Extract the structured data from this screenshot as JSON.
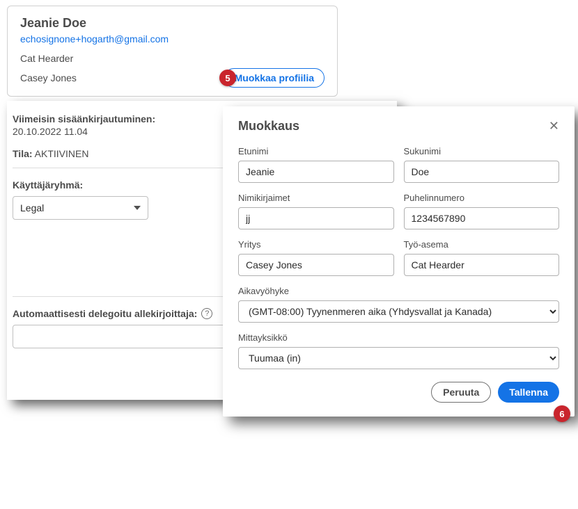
{
  "profile": {
    "name": "Jeanie Doe",
    "email": "echosignone+hogarth@gmail.com",
    "role": "Cat Hearder",
    "company": "Casey Jones",
    "edit_button": "Muokkaa profiilia"
  },
  "steps": {
    "five": "5",
    "six": "6"
  },
  "panel": {
    "last_login_label": "Viimeisin sisäänkirjautuminen:",
    "last_login_value": "20.10.2022 11.04",
    "status_label": "Tila:",
    "status_value": "AKTIIVINEN",
    "group_label": "Käyttäjäryhmä:",
    "group_value": "Legal",
    "delegate_label": "Automaattisesti delegoitu allekirjoittaja:"
  },
  "modal": {
    "title": "Muokkaus",
    "fields": {
      "firstname_label": "Etunimi",
      "firstname_value": "Jeanie",
      "lastname_label": "Sukunimi",
      "lastname_value": "Doe",
      "initials_label": "Nimikirjaimet",
      "initials_value": "jj",
      "phone_label": "Puhelinnumero",
      "phone_value": "1234567890",
      "company_label": "Yritys",
      "company_value": "Casey Jones",
      "jobtitle_label": "Työ-asema",
      "jobtitle_value": "Cat Hearder",
      "timezone_label": "Aikavyöhyke",
      "timezone_value": "(GMT-08:00) Tyynenmeren aika (Yhdysvallat ja Kanada)",
      "unit_label": "Mittayksikkö",
      "unit_value": "Tuumaa (in)"
    },
    "cancel": "Peruuta",
    "save": "Tallenna"
  }
}
